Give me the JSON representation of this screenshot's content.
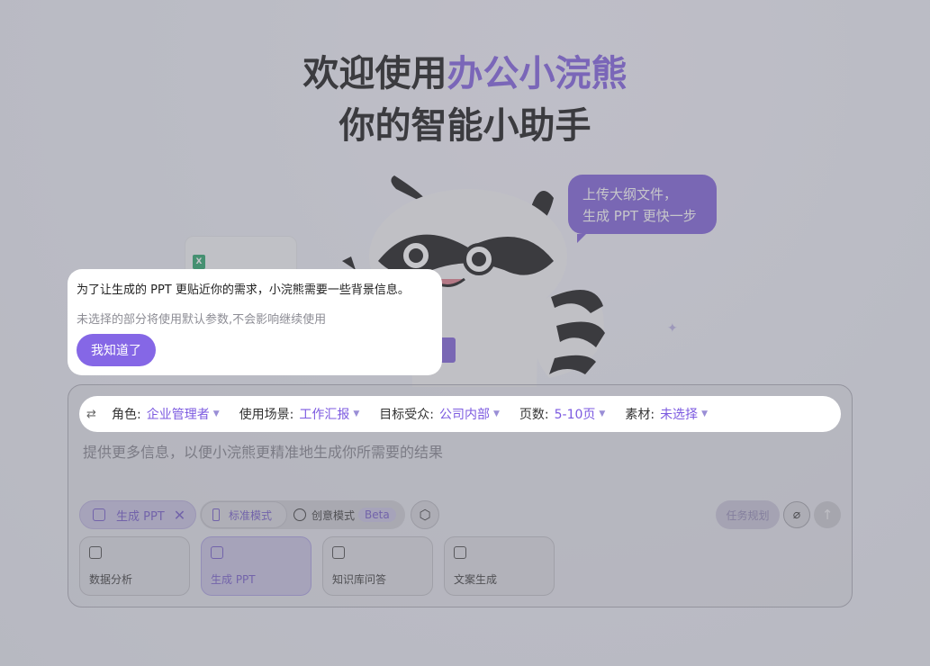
{
  "hero": {
    "title_prefix": "欢迎使用",
    "brand": "办公小浣熊",
    "subtitle": "你的智能小助手"
  },
  "bubble": {
    "line1": "上传大纲文件，",
    "line2": "生成 PPT 更快一步"
  },
  "tooltip": {
    "line1": "为了让生成的 PPT 更贴近你的需求，小浣熊需要一些背景信息。",
    "line2": "未选择的部分将使用默认参数,不会影响继续使用",
    "button": "我知道了"
  },
  "params": [
    {
      "label": "角色:",
      "value": "企业管理者"
    },
    {
      "label": "使用场景:",
      "value": "工作汇报"
    },
    {
      "label": "目标受众:",
      "value": "公司内部"
    },
    {
      "label": "页数:",
      "value": "5-10页"
    },
    {
      "label": "素材:",
      "value": "未选择"
    }
  ],
  "input": {
    "placeholder": "提供更多信息，以便小浣熊更精准地生成你所需要的结果"
  },
  "modes": {
    "active_chip": "生成 PPT",
    "standard": "标准模式",
    "creative": "创意模式",
    "beta": "Beta"
  },
  "actions": {
    "task": "任务规划"
  },
  "skills": [
    {
      "label": "数据分析"
    },
    {
      "label": "生成 PPT"
    },
    {
      "label": "知识库问答"
    },
    {
      "label": "文案生成"
    }
  ],
  "file_card": {
    "badge": "X"
  },
  "colors": {
    "accent": "#7c5ae0",
    "bubble": "#7b5cd9",
    "button": "#8567e6"
  }
}
